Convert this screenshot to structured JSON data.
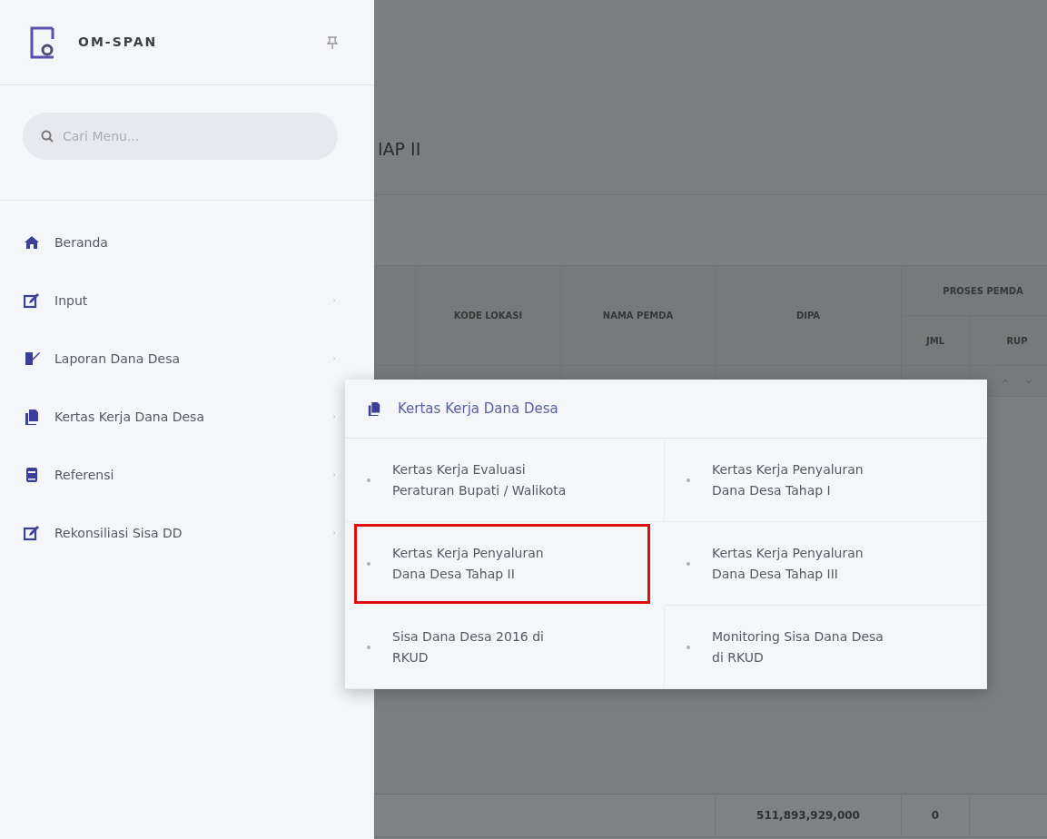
{
  "sidebar": {
    "brand": "OM-SPAN",
    "search": {
      "placeholder": "Cari Menu..."
    },
    "items": [
      {
        "label": "Beranda",
        "has_submenu": false
      },
      {
        "label": "Input",
        "has_submenu": true
      },
      {
        "label": "Laporan Dana Desa",
        "has_submenu": true
      },
      {
        "label": "Kertas Kerja Dana Desa",
        "has_submenu": true
      },
      {
        "label": "Referensi",
        "has_submenu": true
      },
      {
        "label": "Rekonsiliasi Sisa DD",
        "has_submenu": true
      }
    ]
  },
  "page_title": "IAP II",
  "table": {
    "columns": [
      {
        "label": "KODE LOKASI"
      },
      {
        "label": "NAMA PEMDA"
      },
      {
        "label": "DIPA"
      },
      {
        "label": "PROSES PEMDA",
        "children": [
          {
            "label": "JML"
          },
          {
            "label": "RUP"
          }
        ]
      }
    ],
    "total_row": {
      "dipa": "511,893,929,000",
      "jml": "0"
    }
  },
  "flyout": {
    "title": "Kertas Kerja Dana Desa",
    "items": [
      {
        "label": "Kertas Kerja Evaluasi Peraturan Bupati / Walikota",
        "highlighted": false
      },
      {
        "label": "Kertas Kerja Penyaluran Dana Desa Tahap I",
        "highlighted": false
      },
      {
        "label": "Kertas Kerja Penyaluran Dana Desa Tahap II",
        "highlighted": true
      },
      {
        "label": "Kertas Kerja Penyaluran Dana Desa Tahap III",
        "highlighted": false
      },
      {
        "label": "Sisa Dana Desa 2016 di RKUD",
        "highlighted": false
      },
      {
        "label": "Monitoring Sisa Dana Desa di RKUD",
        "highlighted": false
      }
    ]
  }
}
